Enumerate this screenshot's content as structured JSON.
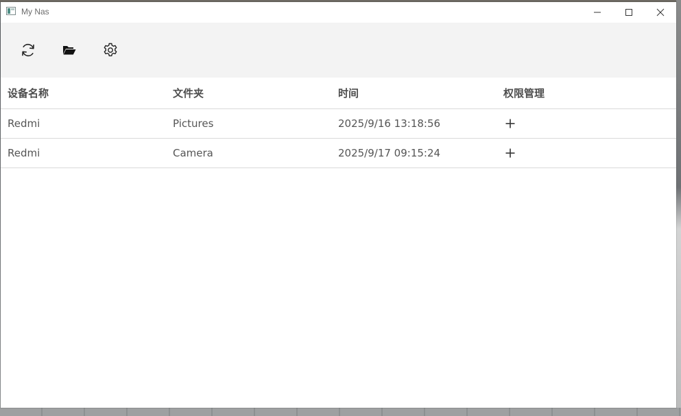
{
  "window": {
    "title": "My Nas"
  },
  "toolbar": {
    "buttons": [
      {
        "icon": "refresh-icon"
      },
      {
        "icon": "folder-open-icon"
      },
      {
        "icon": "gear-icon"
      }
    ]
  },
  "table": {
    "columns": [
      "设备名称",
      "文件夹",
      "时间",
      "权限管理"
    ],
    "rows": [
      {
        "device": "Redmi",
        "folder": "Pictures",
        "time": "2025/9/16 13:18:56",
        "action_icon": "plus-icon"
      },
      {
        "device": "Redmi",
        "folder": "Camera",
        "time": "2025/9/17 09:15:24",
        "action_icon": "plus-icon"
      }
    ]
  },
  "colors": {
    "toolbar_bg": "#f3f3f3",
    "divider": "#d9d9d9",
    "text": "#555555"
  }
}
